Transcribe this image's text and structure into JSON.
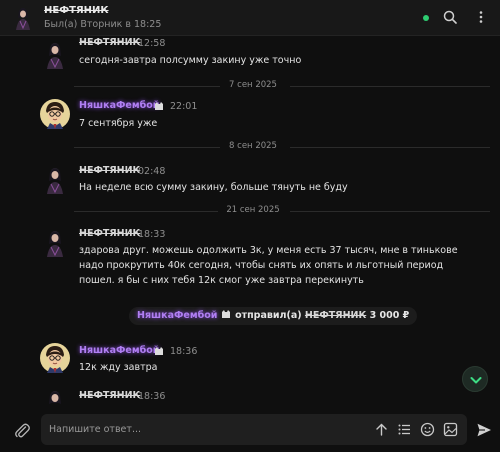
{
  "header": {
    "title": "НЕФТЯНИК",
    "status": "Был(а) Вторник в 18:25",
    "online_color": "#2ecc71"
  },
  "messages": [
    {
      "author": "НЕФТЯНИК",
      "time": "12:58",
      "text": "сегодня-завтра полсумму закину уже точно"
    },
    {
      "author": "НяшкаФембой",
      "badge_icon": "cat-icon",
      "time": "22:01",
      "text": "7 сентября уже"
    },
    {
      "author": "НЕФТЯНИК",
      "time": "02:48",
      "text": "На неделе всю сумму закину, больше тянуть не буду"
    },
    {
      "author": "НЕФТЯНИК",
      "time": "18:33",
      "text": "здарова друг. можешь одолжить 3к, у меня есть 37 тысяч, мне в тинькове надо прокрутить 40к сегодня, чтобы снять их опять и льготный период пошел. я бы с них тебя 12к смог уже завтра перекинуть"
    },
    {
      "author": "НяшкаФембой",
      "badge_icon": "cat-icon",
      "time": "18:36",
      "text": "12к жду завтра"
    },
    {
      "author": "НЕФТЯНИК",
      "time": "18:36"
    }
  ],
  "date_separators": [
    "7 сен 2025",
    "8 сен 2025",
    "21 сен 2025"
  ],
  "transfer": {
    "sender": "НяшкаФембой",
    "action": "отправил(а)",
    "recipient": "НЕФТЯНИК",
    "amount": "3 000 ₽"
  },
  "composer": {
    "placeholder": "Напишите ответ..."
  },
  "colors": {
    "accent_purple": "#b07ff2",
    "scroll_button_arrow": "#3ddc84"
  }
}
